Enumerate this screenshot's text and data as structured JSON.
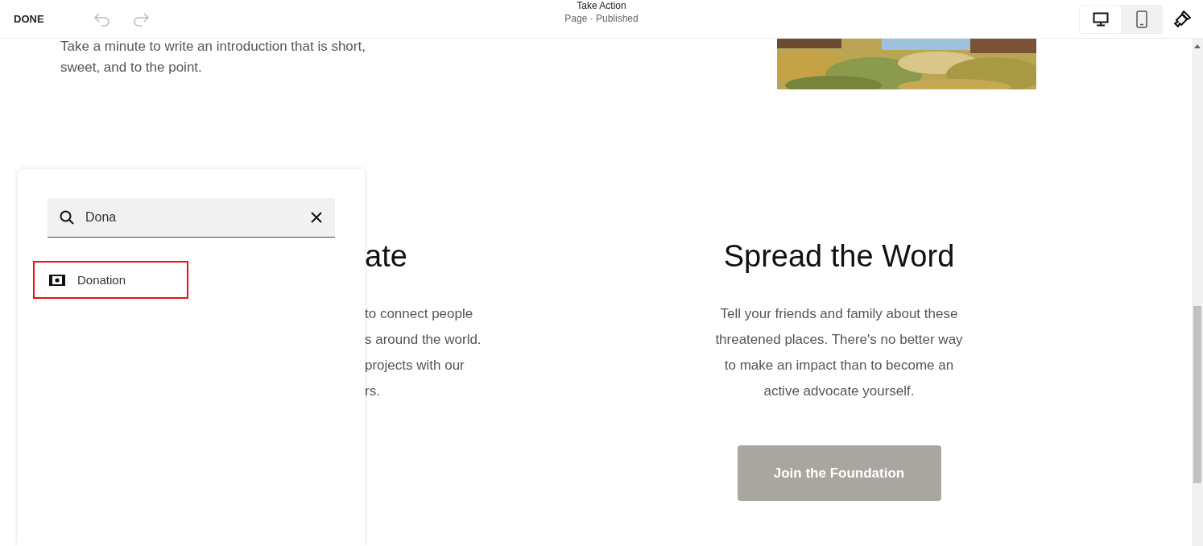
{
  "toolbar": {
    "done": "DONE",
    "undo": {
      "disabled": true
    },
    "redo": {
      "disabled": true
    },
    "title": "Take Action",
    "subtitle": "Page · Published",
    "views": [
      {
        "kind": "desktop",
        "selected": true
      },
      {
        "kind": "mobile",
        "selected": false
      }
    ]
  },
  "intro": {
    "lines": [
      "Take a minute to write an introduction that is short,",
      "sweet, and to the point."
    ]
  },
  "columns": [
    {
      "heading": "ate",
      "lines": [
        "to connect people",
        "s around the world.",
        "projects with our",
        "rs."
      ]
    },
    {
      "heading": "Spread the Word",
      "lines": [
        "Tell your friends and family about these",
        "threatened places. There's no better way",
        "to make an impact than to become an",
        "active advocate yourself."
      ],
      "button": "Join the Foundation"
    }
  ],
  "search_panel": {
    "query": "Dona",
    "results": [
      {
        "label": "Donation",
        "selected": true
      }
    ]
  }
}
